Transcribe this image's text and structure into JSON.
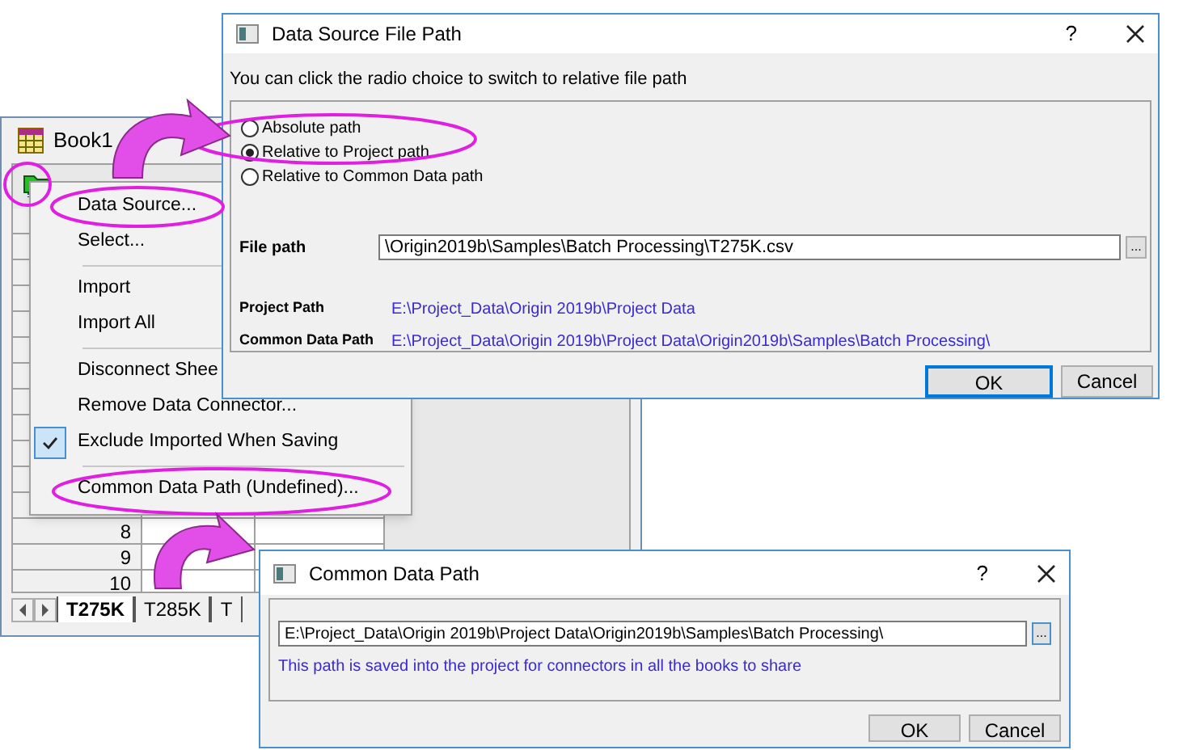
{
  "book_window": {
    "title": "Book1",
    "row_numbers": [
      "8",
      "9",
      "10"
    ],
    "sheet_tabs": [
      {
        "label": "T275K",
        "selected": true
      },
      {
        "label": "T285K",
        "selected": false
      },
      {
        "label": "T",
        "selected": false
      }
    ]
  },
  "context_menu": {
    "items": [
      {
        "kind": "item",
        "label": "Data Source...",
        "checked": false
      },
      {
        "kind": "item",
        "label": "Select...",
        "checked": false
      },
      {
        "kind": "separator"
      },
      {
        "kind": "item",
        "label": "Import",
        "checked": false
      },
      {
        "kind": "item",
        "label": "Import All",
        "checked": false
      },
      {
        "kind": "separator"
      },
      {
        "kind": "item",
        "label": "Disconnect Shee",
        "checked": false
      },
      {
        "kind": "item",
        "label": "Remove Data Connector...",
        "checked": false
      },
      {
        "kind": "item",
        "label": "Exclude Imported When Saving",
        "checked": true
      },
      {
        "kind": "separator"
      },
      {
        "kind": "item",
        "label": "Common Data Path (Undefined)...",
        "checked": false
      }
    ]
  },
  "data_source_dialog": {
    "title": "Data Source File Path",
    "help": "?",
    "hint": "You can click the radio choice to switch to relative file path",
    "radios": [
      {
        "label": "Absolute path",
        "selected": false
      },
      {
        "label": "Relative to Project path",
        "selected": true
      },
      {
        "label": "Relative to Common Data path",
        "selected": false
      }
    ],
    "file_path": {
      "label": "File path",
      "value": "\\Origin2019b\\Samples\\Batch Processing\\T275K.csv",
      "browse": "..."
    },
    "info": [
      {
        "label": "Project Path",
        "value": "E:\\Project_Data\\Origin 2019b\\Project Data"
      },
      {
        "label": "Common Data Path",
        "value": "E:\\Project_Data\\Origin 2019b\\Project Data\\Origin2019b\\Samples\\Batch Processing\\"
      }
    ],
    "buttons": [
      {
        "label": "OK",
        "default": true
      },
      {
        "label": "Cancel",
        "default": false
      }
    ]
  },
  "common_path_dialog": {
    "title": "Common Data Path",
    "help": "?",
    "value": "E:\\Project_Data\\Origin 2019b\\Project Data\\Origin2019b\\Samples\\Batch Processing\\",
    "browse": "...",
    "note": "This path is saved into the project for connectors in all the books to share",
    "buttons": [
      {
        "label": "OK",
        "default": false
      },
      {
        "label": "Cancel",
        "default": false
      }
    ]
  }
}
